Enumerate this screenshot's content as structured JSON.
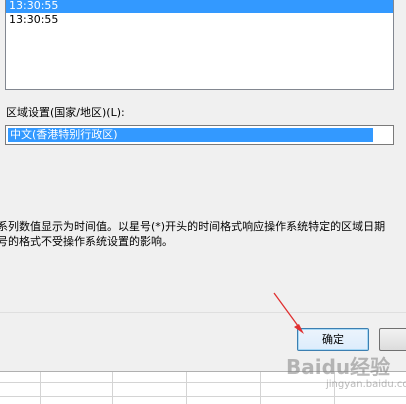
{
  "time_list": {
    "items": [
      "13:30:55",
      "13:30:55"
    ],
    "selected_index": 0
  },
  "region": {
    "label": "区域设置(国家/地区)(L):",
    "selected": "中文(香港特别行政区)"
  },
  "description": {
    "line1": "系列数值显示为时间值。以星号(*)开头的时间格式响应操作系统特定的区域日期",
    "line2": "号的格式不受操作系统设置的影响。"
  },
  "buttons": {
    "ok_label": "确定"
  },
  "watermark": {
    "text": "Baidu经验",
    "sub": "jingyan.baidu.com"
  },
  "colors": {
    "selection": "#3399ff",
    "arrow": "#e03030"
  }
}
